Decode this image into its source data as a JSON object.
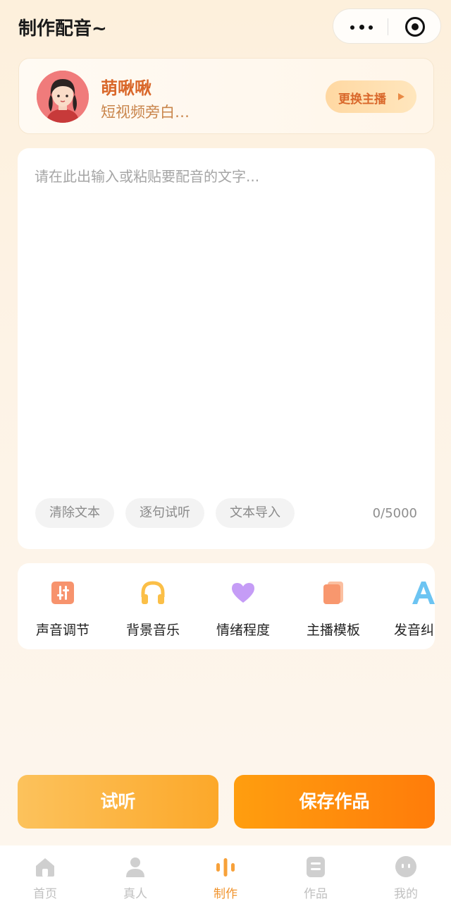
{
  "header": {
    "title": "制作配音~"
  },
  "anchor": {
    "name": "萌啾啾",
    "desc": "短视频旁白…",
    "switch_label": "更换主播"
  },
  "editor": {
    "placeholder": "请在此出输入或粘贴要配音的文字...",
    "clear_label": "清除文本",
    "sentence_label": "逐句试听",
    "import_label": "文本导入",
    "char_count": "0/5000"
  },
  "tools": [
    {
      "label": "声音调节",
      "icon": "sliders-icon"
    },
    {
      "label": "背景音乐",
      "icon": "headphones-icon"
    },
    {
      "label": "情绪程度",
      "icon": "heart-icon"
    },
    {
      "label": "主播模板",
      "icon": "template-icon"
    },
    {
      "label": "发音纠",
      "icon": "pronunciation-icon"
    }
  ],
  "actions": {
    "listen_label": "试听",
    "save_label": "保存作品"
  },
  "tabbar": [
    {
      "label": "首页",
      "icon": "home-icon",
      "active": false
    },
    {
      "label": "真人",
      "icon": "person-icon",
      "active": false
    },
    {
      "label": "制作",
      "icon": "audio-bars-icon",
      "active": true
    },
    {
      "label": "作品",
      "icon": "works-icon",
      "active": false
    },
    {
      "label": "我的",
      "icon": "profile-face-icon",
      "active": false
    }
  ],
  "colors": {
    "accent": "#ff8c1a",
    "anchor_name": "#d9672a",
    "tab_active": "#f0932c"
  }
}
